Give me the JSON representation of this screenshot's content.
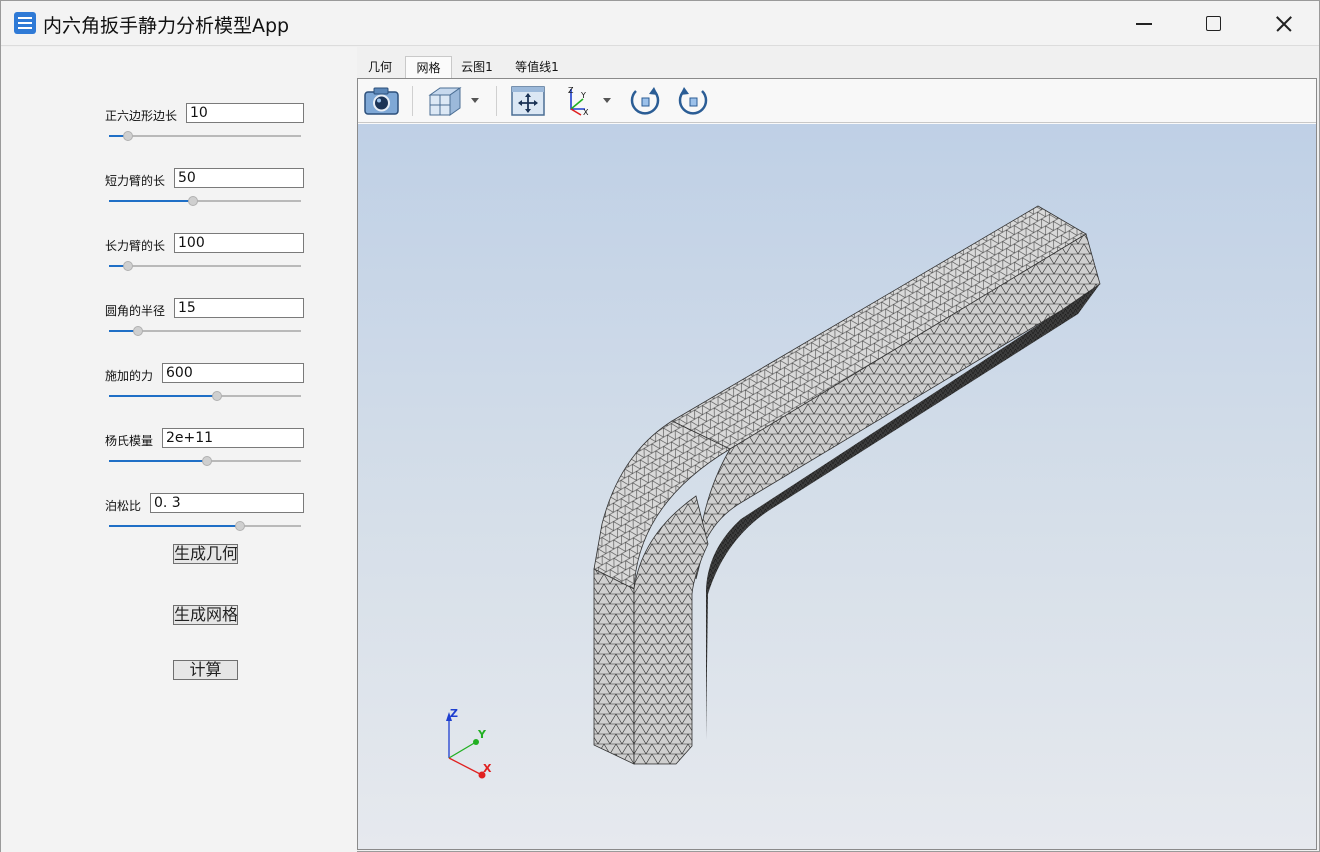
{
  "window": {
    "title": "内六角扳手静力分析模型App"
  },
  "params": [
    {
      "label": "正六边形边长",
      "value": "10",
      "slider": 0.1
    },
    {
      "label": "短力臂的长",
      "value": "50",
      "slider": 0.44
    },
    {
      "label": "长力臂的长",
      "value": "100",
      "slider": 0.1
    },
    {
      "label": "圆角的半径",
      "value": "15",
      "slider": 0.15
    },
    {
      "label": "施加的力",
      "value": "600",
      "slider": 0.56
    },
    {
      "label": "杨氏模量",
      "value": "2e+11",
      "slider": 0.51
    },
    {
      "label": "泊松比",
      "value": "0. 3",
      "slider": 0.68
    }
  ],
  "buttons": {
    "geometry": "生成几何",
    "mesh": "生成网格",
    "compute": "计算"
  },
  "tabs": [
    "几何",
    "网格",
    "云图1",
    "等值线1"
  ],
  "active_tab": 1,
  "triad": {
    "x": "X",
    "y": "Y",
    "z": "Z"
  },
  "colors": {
    "accent": "#1f6fc6",
    "axis_x": "#e02020",
    "axis_y": "#22b022",
    "axis_z": "#1f3fd0"
  }
}
